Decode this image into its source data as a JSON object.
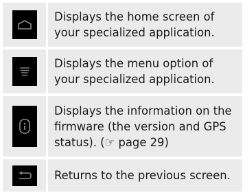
{
  "rows": [
    {
      "icon": "home-icon",
      "text": "Displays the home screen of your specialized application."
    },
    {
      "icon": "menu-icon",
      "text": "Displays the menu option of your specialized application."
    },
    {
      "icon": "info-icon",
      "text": "Displays the information on the firmware (the version and GPS status). (☞ page 29)"
    },
    {
      "icon": "back-icon",
      "text": "Returns to the previous screen."
    }
  ],
  "colors": {
    "row_background": "#ebebeb",
    "icon_background": "#000000",
    "icon_stroke": "#8c8c8c",
    "text": "#1a1a1a"
  }
}
